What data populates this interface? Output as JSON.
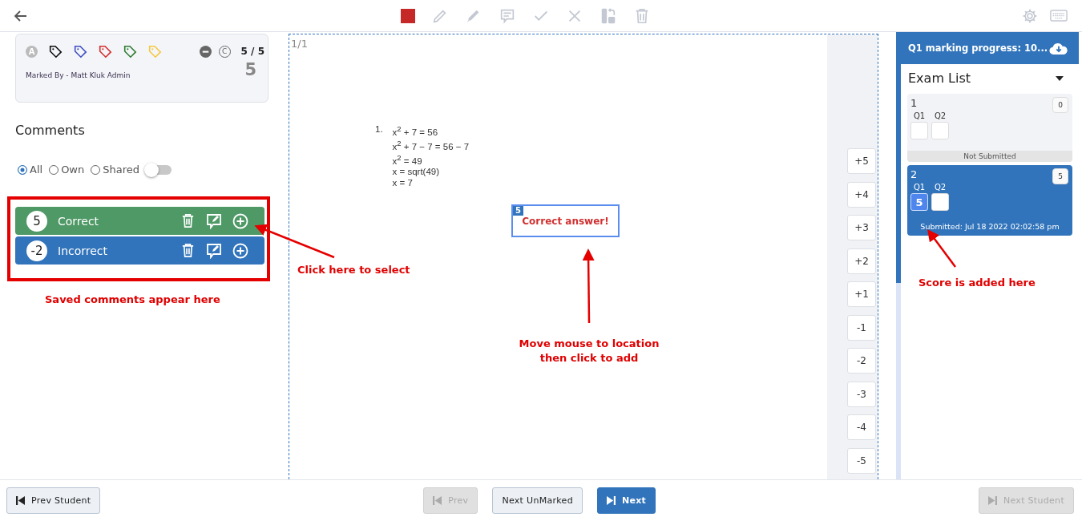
{
  "score_card": {
    "badge": "A",
    "tags": [
      {
        "color": "#111111"
      },
      {
        "color": "#3f4fc4"
      },
      {
        "color": "#d32f2f"
      },
      {
        "color": "#2e7d32"
      },
      {
        "color": "#f5c842"
      }
    ],
    "copyright": "C",
    "score_ratio": "5 / 5",
    "score": "5",
    "marked_by": "Marked By - Matt Kluk Admin"
  },
  "comments": {
    "title": "Comments",
    "filters": [
      {
        "label": "All",
        "selected": true
      },
      {
        "label": "Own",
        "selected": false
      },
      {
        "label": "Shared",
        "selected": false
      }
    ],
    "shared_toggle": {
      "on": false
    },
    "items": [
      {
        "score": "5",
        "label": "Correct",
        "color": "#4e9966"
      },
      {
        "score": "-2",
        "label": "Incorrect",
        "color": "#3174bb"
      }
    ]
  },
  "document": {
    "page": "1/1",
    "number": "1.",
    "lines": [
      "x$^{2}$ + 7 = 56",
      "x$^{2}$ + 7 − 7 = 56 − 7",
      "x$^{2}$ = 49",
      "x = sqrt(49)",
      "x = 7"
    ],
    "comment_box": {
      "score": "5",
      "text": "Correct answer!"
    }
  },
  "score_buttons": [
    "+5",
    "+4",
    "+3",
    "+2",
    "+1",
    "-1",
    "-2",
    "-3",
    "-4",
    "-5"
  ],
  "progress": {
    "title": "Q1 marking progress: 10..."
  },
  "exam_list": {
    "title": "Exam List",
    "exams": [
      {
        "number": "1",
        "total": "0",
        "selected": false,
        "questions": [
          {
            "label": "Q1"
          },
          {
            "label": "Q2"
          }
        ],
        "status": "Not Submitted"
      },
      {
        "number": "2",
        "total": "5",
        "selected": true,
        "questions": [
          {
            "label": "Q1",
            "score": "5"
          },
          {
            "label": "Q2"
          }
        ],
        "status": "Submitted: Jul 18 2022 02:02:58 pm"
      }
    ]
  },
  "footer": [
    {
      "label": "Prev Student",
      "kind": "prev",
      "disabled": false,
      "primary": false
    },
    {
      "label": "Prev",
      "kind": "prev",
      "disabled": true,
      "primary": false
    },
    {
      "label": "Next UnMarked",
      "kind": "plain",
      "disabled": false,
      "primary": false
    },
    {
      "label": "Next",
      "kind": "next",
      "disabled": false,
      "primary": true
    },
    {
      "label": "Next Student",
      "kind": "next",
      "disabled": true,
      "primary": false
    }
  ],
  "annotations": [
    "Saved comments appear here",
    "Click here to select",
    "Move mouse to location then click to add",
    "Score is added here"
  ]
}
